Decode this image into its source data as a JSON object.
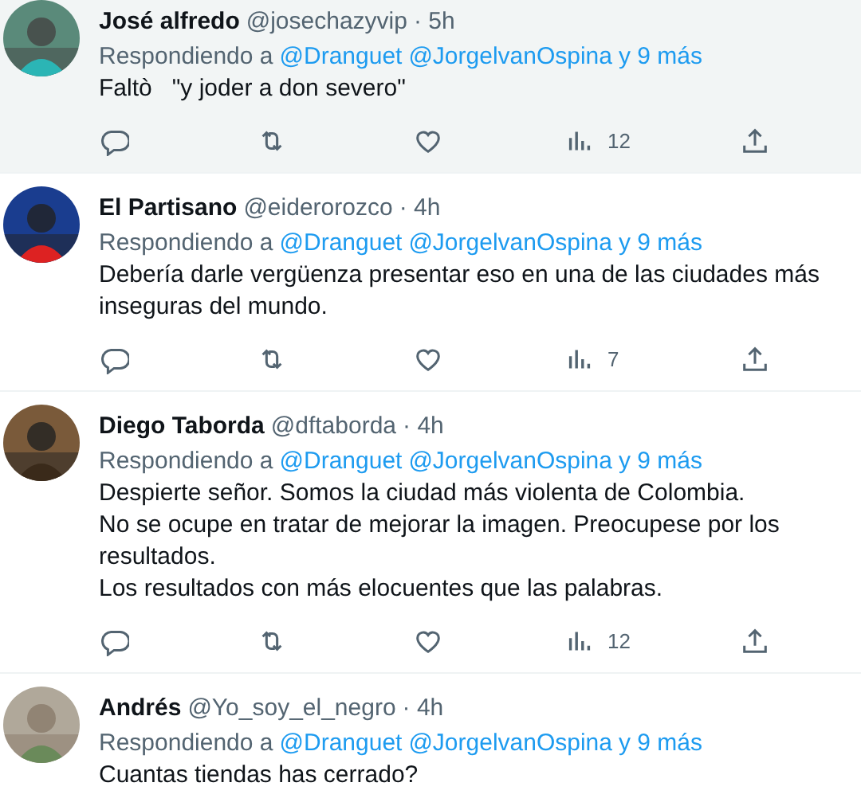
{
  "tweets": [
    {
      "name": "José alfredo",
      "handle": "@josechazyvip",
      "time": "· 5h",
      "replying": "Respondiendo a",
      "mentions": [
        "@Dranguet",
        "@JorgelvanOspina"
      ],
      "more": "y 9 más",
      "text": [
        "Faltò   \"y joder a don severo\""
      ],
      "hovered": true,
      "views": "12"
    },
    {
      "name": "El Partisano",
      "handle": "@eiderorozco",
      "time": "· 4h",
      "replying": "Respondiendo a",
      "mentions": [
        "@Dranguet",
        "@JorgelvanOspina"
      ],
      "more": "y 9 más",
      "text": [
        "Debería darle vergüenza presentar eso en una de las ciudades más inseguras del mundo."
      ],
      "hovered": false,
      "views": "7"
    },
    {
      "name": "Diego Taborda",
      "handle": "@dftaborda",
      "time": "· 4h",
      "replying": "Respondiendo a",
      "mentions": [
        "@Dranguet",
        "@JorgelvanOspina"
      ],
      "more": "y 9 más",
      "text": [
        "Despierte señor. Somos la ciudad más violenta de Colombia.",
        "No se ocupe en tratar de mejorar la imagen. Preocupese por los resultados.",
        "Los resultados con más elocuentes que las palabras."
      ],
      "hovered": false,
      "views": "12"
    },
    {
      "name": "Andrés",
      "handle": "@Yo_soy_el_negro",
      "time": "· 4h",
      "replying": "Respondiendo a",
      "mentions": [
        "@Dranguet",
        "@JorgelvanOspina"
      ],
      "more": "y 9 más",
      "text": [
        "Cuantas tiendas has cerrado?"
      ],
      "hovered": false
    }
  ]
}
